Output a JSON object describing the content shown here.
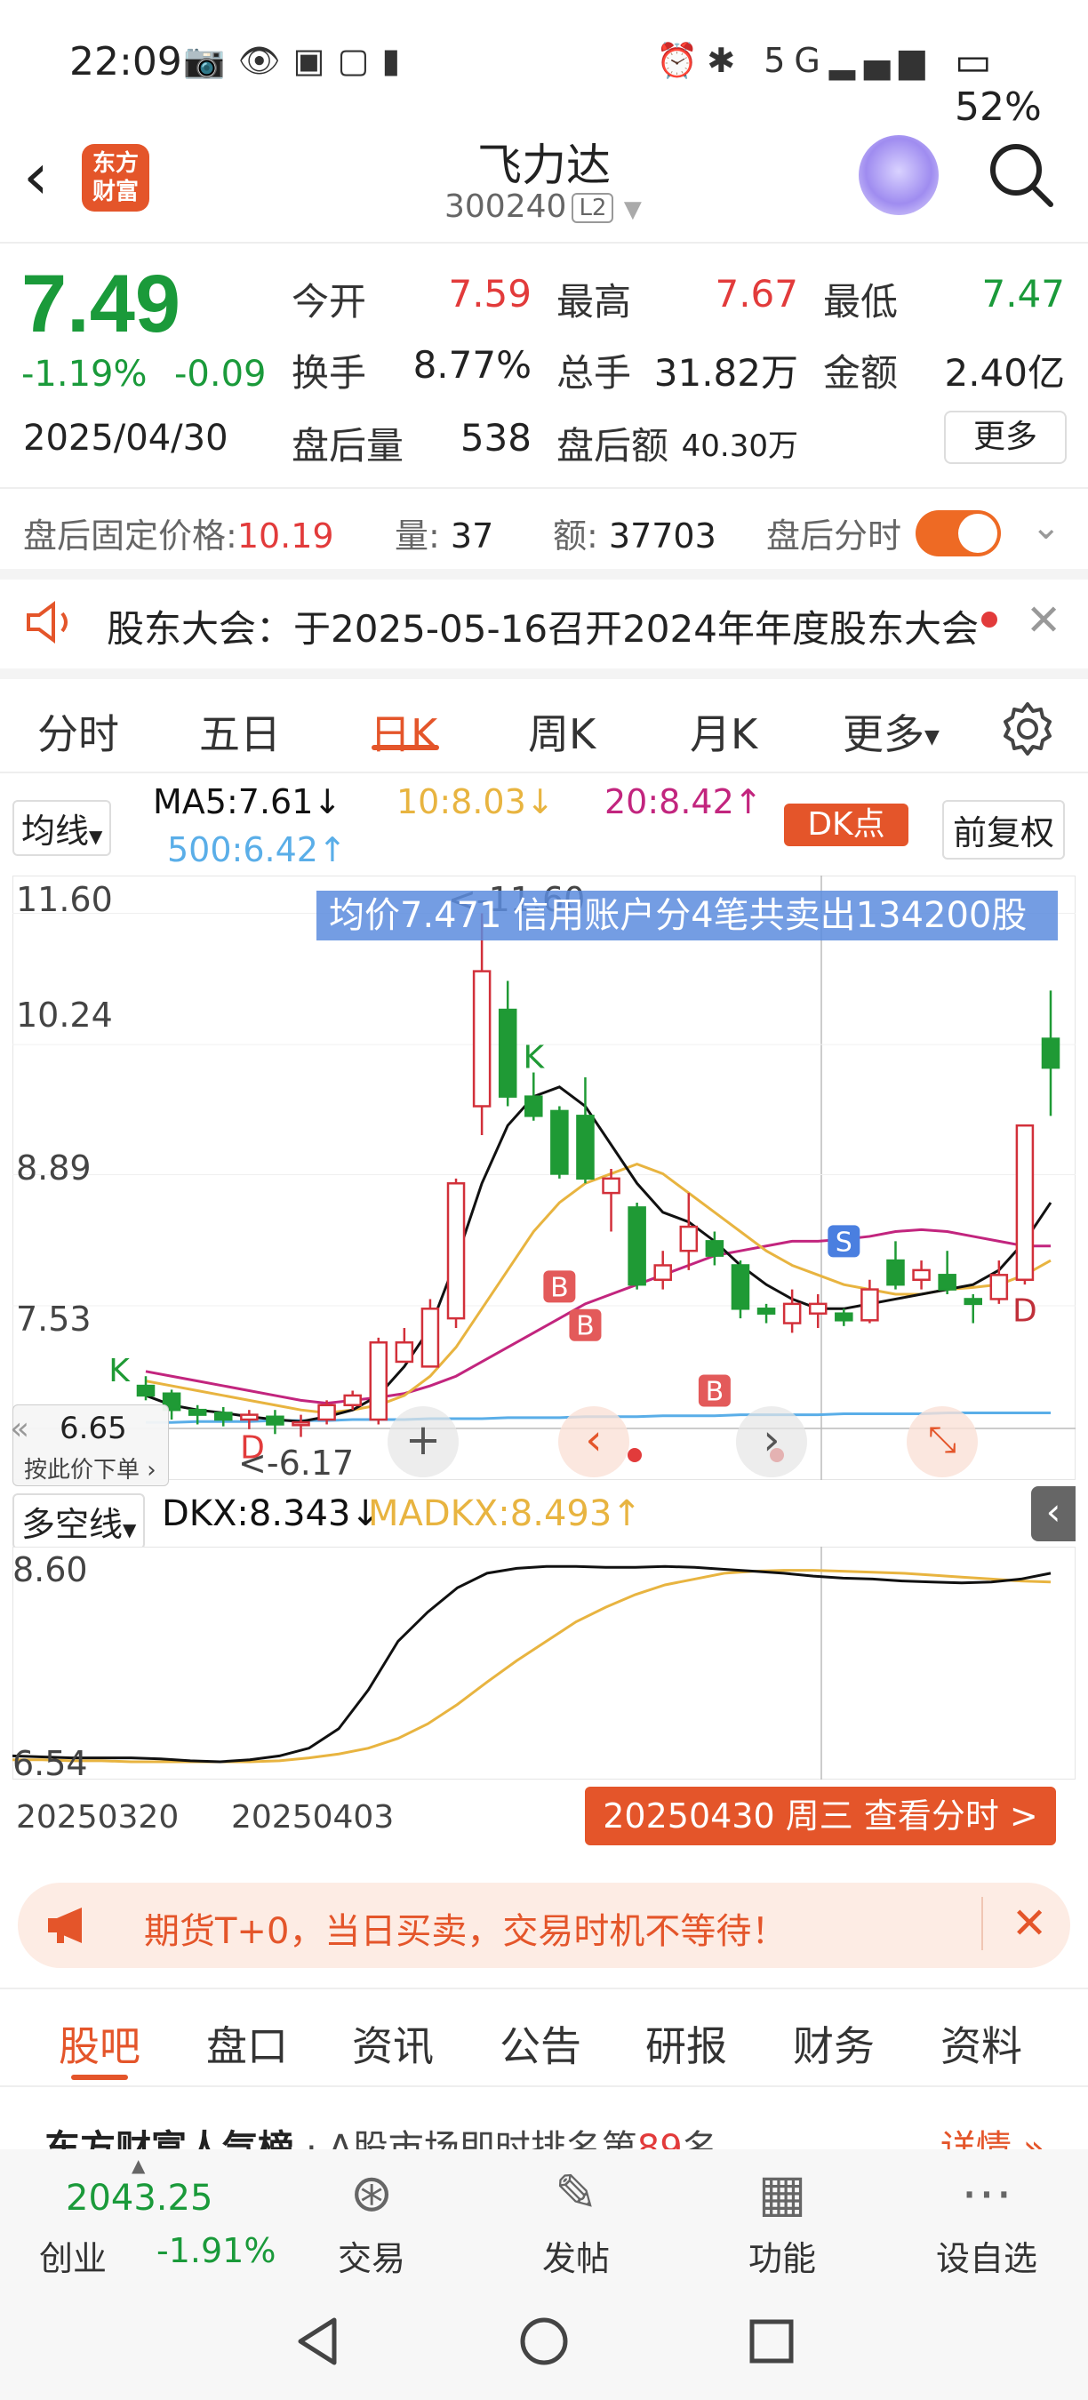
{
  "status_bar": {
    "time": "22:09",
    "network": "5G",
    "battery": "52%"
  },
  "header": {
    "logo_text_line1": "东方",
    "logo_text_line2": "财富",
    "stock_name": "飞力达",
    "stock_code": "300240",
    "level_badge": "L2"
  },
  "quote": {
    "price": "7.49",
    "change_pct": "-1.19%",
    "change": "-0.09",
    "date": "2025/04/30",
    "fields": [
      {
        "label": "今开",
        "value": "7.59",
        "color": "#e23b3b"
      },
      {
        "label": "最高",
        "value": "7.67",
        "color": "#e23b3b"
      },
      {
        "label": "最低",
        "value": "7.47",
        "color": "#1a9a3a"
      },
      {
        "label": "换手",
        "value": "8.77%",
        "color": "#222222"
      },
      {
        "label": "总手",
        "value": "31.82万",
        "color": "#222222"
      },
      {
        "label": "金额",
        "value": "2.40亿",
        "color": "#222222"
      },
      {
        "label": "盘后量",
        "value": "538",
        "color": "#222222"
      },
      {
        "label": "盘后额",
        "value": "40.30万",
        "color": "#222222"
      }
    ],
    "more_label": "更多"
  },
  "after_hours": {
    "fixed_price_label": "盘后固定价格:",
    "fixed_price_value": "10.19",
    "volume_label": "量:",
    "volume_value": "37",
    "amount_label": "额:",
    "amount_value": "37703",
    "toggle_label": "盘后分时",
    "toggle_on": true
  },
  "notice": {
    "text": "股东大会：于2025-05-16召开2024年年度股东大会"
  },
  "tabs": [
    {
      "label": "分时",
      "active": false
    },
    {
      "label": "五日",
      "active": false
    },
    {
      "label": "日K",
      "active": true
    },
    {
      "label": "周K",
      "active": false
    },
    {
      "label": "月K",
      "active": false
    },
    {
      "label": "更多",
      "active": false
    }
  ],
  "ma_bar": {
    "selector": "均线",
    "ma5": "MA5:7.61",
    "ma10": "10:8.03",
    "ma20": "20:8.42",
    "ma500": "500:6.42",
    "dk_point": "DK点",
    "adjust": "前复权",
    "colors": {
      "ma5": "#111111",
      "ma10": "#e8b440",
      "ma20": "#c2257e",
      "ma500": "#5aaee8"
    }
  },
  "kline": {
    "banner": "均价7.471  信用账户分4笔共卖出134200股",
    "price_axis": [
      "11.60",
      "10.24",
      "8.89",
      "7.53"
    ],
    "high_label": "11.60",
    "low_label": "6.17",
    "cursor_price": "6.65",
    "cursor_hint": "按此价下单",
    "markers": [
      "K",
      "K",
      "D",
      "B",
      "B",
      "B",
      "S",
      "D"
    ]
  },
  "chart_data": {
    "type": "candlestick",
    "x_start": "20250320",
    "x_mid": "20250403",
    "x_end": "20250430",
    "ylim": [
      6.17,
      11.6
    ],
    "candles": [
      {
        "o": 6.7,
        "c": 6.6,
        "h": 6.8,
        "l": 6.55
      },
      {
        "o": 6.62,
        "c": 6.45,
        "h": 6.66,
        "l": 6.35
      },
      {
        "o": 6.45,
        "c": 6.4,
        "h": 6.5,
        "l": 6.3
      },
      {
        "o": 6.42,
        "c": 6.35,
        "h": 6.48,
        "l": 6.28
      },
      {
        "o": 6.35,
        "c": 6.4,
        "h": 6.45,
        "l": 6.25
      },
      {
        "o": 6.38,
        "c": 6.3,
        "h": 6.45,
        "l": 6.2
      },
      {
        "o": 6.3,
        "c": 6.32,
        "h": 6.4,
        "l": 6.17
      },
      {
        "o": 6.35,
        "c": 6.5,
        "h": 6.55,
        "l": 6.3
      },
      {
        "o": 6.5,
        "c": 6.6,
        "h": 6.65,
        "l": 6.45
      },
      {
        "o": 6.35,
        "c": 7.15,
        "h": 7.2,
        "l": 6.3
      },
      {
        "o": 6.95,
        "c": 7.15,
        "h": 7.3,
        "l": 6.95
      },
      {
        "o": 6.9,
        "c": 7.5,
        "h": 7.6,
        "l": 6.9
      },
      {
        "o": 7.4,
        "c": 8.8,
        "h": 8.85,
        "l": 7.3
      },
      {
        "o": 9.6,
        "c": 11.0,
        "h": 11.6,
        "l": 9.3
      },
      {
        "o": 10.6,
        "c": 9.7,
        "h": 10.9,
        "l": 9.6
      },
      {
        "o": 9.7,
        "c": 9.5,
        "h": 9.95,
        "l": 9.45
      },
      {
        "o": 9.55,
        "c": 8.9,
        "h": 9.6,
        "l": 8.85
      },
      {
        "o": 9.5,
        "c": 8.85,
        "h": 9.9,
        "l": 8.8
      },
      {
        "o": 8.7,
        "c": 8.85,
        "h": 8.95,
        "l": 8.3
      },
      {
        "o": 8.55,
        "c": 7.75,
        "h": 8.6,
        "l": 7.7
      },
      {
        "o": 7.8,
        "c": 7.95,
        "h": 8.1,
        "l": 7.7
      },
      {
        "o": 8.1,
        "c": 8.35,
        "h": 8.7,
        "l": 7.9
      },
      {
        "o": 8.2,
        "c": 8.05,
        "h": 8.3,
        "l": 7.95
      },
      {
        "o": 7.95,
        "c": 7.5,
        "h": 8.0,
        "l": 7.4
      },
      {
        "o": 7.5,
        "c": 7.45,
        "h": 7.55,
        "l": 7.35
      },
      {
        "o": 7.35,
        "c": 7.55,
        "h": 7.7,
        "l": 7.25
      },
      {
        "o": 7.45,
        "c": 7.55,
        "h": 7.65,
        "l": 7.3
      },
      {
        "o": 7.45,
        "c": 7.38,
        "h": 7.5,
        "l": 7.32
      },
      {
        "o": 7.38,
        "c": 7.7,
        "h": 7.8,
        "l": 7.35
      },
      {
        "o": 8.0,
        "c": 7.75,
        "h": 8.2,
        "l": 7.7
      },
      {
        "o": 7.8,
        "c": 7.9,
        "h": 8.0,
        "l": 7.7
      },
      {
        "o": 7.85,
        "c": 7.7,
        "h": 8.1,
        "l": 7.65
      },
      {
        "o": 7.6,
        "c": 7.55,
        "h": 7.65,
        "l": 7.35
      },
      {
        "o": 7.6,
        "c": 7.85,
        "h": 8.0,
        "l": 7.55
      },
      {
        "o": 7.8,
        "c": 9.4,
        "h": 9.4,
        "l": 7.75
      },
      {
        "o": 10.3,
        "c": 10.0,
        "h": 10.8,
        "l": 9.5
      }
    ],
    "ma5": [
      6.6,
      6.5,
      6.45,
      6.42,
      6.38,
      6.35,
      6.33,
      6.38,
      6.45,
      6.6,
      6.9,
      7.3,
      8.0,
      8.8,
      9.4,
      9.7,
      9.8,
      9.6,
      9.2,
      8.8,
      8.5,
      8.4,
      8.2,
      7.95,
      7.75,
      7.6,
      7.5,
      7.5,
      7.55,
      7.6,
      7.65,
      7.7,
      7.75,
      7.9,
      8.2,
      8.6
    ],
    "ma10": [
      6.75,
      6.7,
      6.65,
      6.6,
      6.55,
      6.5,
      6.45,
      6.42,
      6.45,
      6.5,
      6.6,
      6.8,
      7.1,
      7.5,
      7.9,
      8.3,
      8.6,
      8.8,
      8.9,
      9.0,
      8.9,
      8.7,
      8.5,
      8.3,
      8.1,
      7.95,
      7.85,
      7.75,
      7.7,
      7.65,
      7.65,
      7.7,
      7.72,
      7.75,
      7.85,
      8.0
    ],
    "ma20": [
      6.85,
      6.8,
      6.75,
      6.7,
      6.65,
      6.6,
      6.55,
      6.52,
      6.55,
      6.58,
      6.62,
      6.7,
      6.8,
      6.95,
      7.1,
      7.25,
      7.4,
      7.55,
      7.65,
      7.75,
      7.85,
      7.95,
      8.05,
      8.1,
      8.15,
      8.2,
      8.2,
      8.22,
      8.25,
      8.3,
      8.32,
      8.3,
      8.25,
      8.2,
      8.15,
      8.15
    ],
    "ma500": [
      6.32,
      6.32,
      6.33,
      6.33,
      6.33,
      6.34,
      6.34,
      6.34,
      6.35,
      6.35,
      6.35,
      6.36,
      6.36,
      6.36,
      6.37,
      6.37,
      6.37,
      6.38,
      6.38,
      6.38,
      6.39,
      6.39,
      6.39,
      6.4,
      6.4,
      6.4,
      6.4,
      6.41,
      6.41,
      6.41,
      6.41,
      6.42,
      6.42,
      6.42,
      6.42,
      6.42
    ],
    "dkx": [
      6.62,
      6.61,
      6.6,
      6.6,
      6.6,
      6.59,
      6.57,
      6.56,
      6.58,
      6.62,
      6.7,
      6.9,
      7.3,
      7.8,
      8.1,
      8.35,
      8.5,
      8.55,
      8.57,
      8.57,
      8.56,
      8.56,
      8.57,
      8.56,
      8.54,
      8.52,
      8.5,
      8.47,
      8.45,
      8.44,
      8.42,
      8.41,
      8.4,
      8.41,
      8.44,
      8.5
    ],
    "madkx": [
      6.58,
      6.58,
      6.57,
      6.57,
      6.56,
      6.56,
      6.56,
      6.56,
      6.56,
      6.57,
      6.6,
      6.64,
      6.7,
      6.8,
      6.95,
      7.15,
      7.38,
      7.6,
      7.8,
      8.0,
      8.15,
      8.28,
      8.38,
      8.44,
      8.5,
      8.52,
      8.53,
      8.53,
      8.52,
      8.51,
      8.5,
      8.48,
      8.46,
      8.44,
      8.42,
      8.41
    ]
  },
  "indicator": {
    "selector": "多空线",
    "dkx": "DKX:8.343",
    "madkx": "MADKX:8.493",
    "axis_top": "8.60",
    "axis_bottom": "6.54",
    "date_start": "20250320",
    "date_mid": "20250403",
    "date_button": "20250430 周三 查看分时 >"
  },
  "promo": {
    "text": "期货T+0，当日买卖，交易时机不等待！"
  },
  "bottom_tabs": [
    {
      "label": "股吧",
      "active": true
    },
    {
      "label": "盘口",
      "active": false
    },
    {
      "label": "资讯",
      "active": false
    },
    {
      "label": "公告",
      "active": false
    },
    {
      "label": "研报",
      "active": false
    },
    {
      "label": "财务",
      "active": false
    },
    {
      "label": "资料",
      "active": false
    }
  ],
  "peek_text": "东方财富人气榜",
  "peek_rank_prefix": "A股市场即时排名第",
  "peek_rank": "89",
  "peek_rank_suffix": "名",
  "peek_more": "详情",
  "bottom_nav": {
    "index_value": "2043.25",
    "index_name": "创业",
    "index_change": "-1.91%",
    "items": [
      {
        "label": "交易",
        "icon": "yen-icon"
      },
      {
        "label": "发帖",
        "icon": "edit-icon"
      },
      {
        "label": "功能",
        "icon": "grid-icon"
      },
      {
        "label": "设自选",
        "icon": "more-icon"
      }
    ]
  }
}
